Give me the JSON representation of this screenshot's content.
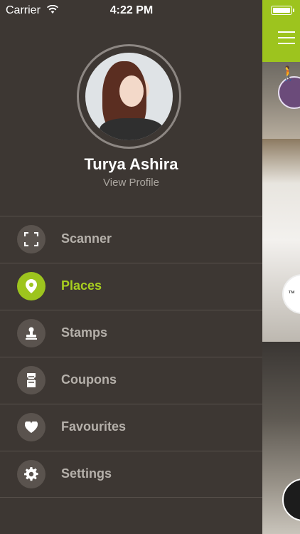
{
  "status_bar": {
    "carrier": "Carrier",
    "time": "4:22 PM"
  },
  "profile": {
    "name": "Turya Ashira",
    "view_profile": "View Profile"
  },
  "menu": [
    {
      "label": "Scanner",
      "icon": "scanner-icon",
      "active": false
    },
    {
      "label": "Places",
      "icon": "location-pin-icon",
      "active": true
    },
    {
      "label": "Stamps",
      "icon": "stamp-icon",
      "active": false
    },
    {
      "label": "Coupons",
      "icon": "coupon-icon",
      "active": false
    },
    {
      "label": "Favourites",
      "icon": "heart-icon",
      "active": false
    },
    {
      "label": "Settings",
      "icon": "gear-icon",
      "active": false
    }
  ],
  "colors": {
    "accent": "#9dc41e",
    "drawer_bg": "#3d3733",
    "menu_text": "#b5b0aa",
    "icon_circle": "#5a534e"
  }
}
